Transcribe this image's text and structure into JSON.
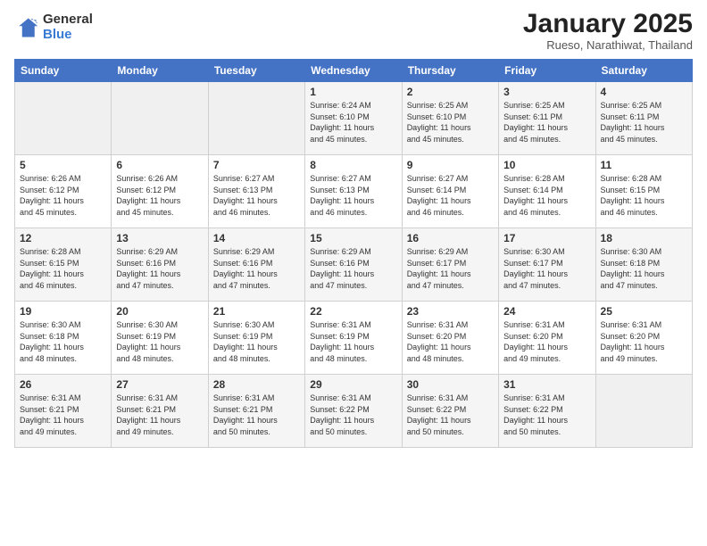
{
  "header": {
    "logo_general": "General",
    "logo_blue": "Blue",
    "title": "January 2025",
    "subtitle": "Rueso, Narathiwat, Thailand"
  },
  "weekdays": [
    "Sunday",
    "Monday",
    "Tuesday",
    "Wednesday",
    "Thursday",
    "Friday",
    "Saturday"
  ],
  "weeks": [
    [
      {
        "day": "",
        "content": ""
      },
      {
        "day": "",
        "content": ""
      },
      {
        "day": "",
        "content": ""
      },
      {
        "day": "1",
        "content": "Sunrise: 6:24 AM\nSunset: 6:10 PM\nDaylight: 11 hours\nand 45 minutes."
      },
      {
        "day": "2",
        "content": "Sunrise: 6:25 AM\nSunset: 6:10 PM\nDaylight: 11 hours\nand 45 minutes."
      },
      {
        "day": "3",
        "content": "Sunrise: 6:25 AM\nSunset: 6:11 PM\nDaylight: 11 hours\nand 45 minutes."
      },
      {
        "day": "4",
        "content": "Sunrise: 6:25 AM\nSunset: 6:11 PM\nDaylight: 11 hours\nand 45 minutes."
      }
    ],
    [
      {
        "day": "5",
        "content": "Sunrise: 6:26 AM\nSunset: 6:12 PM\nDaylight: 11 hours\nand 45 minutes."
      },
      {
        "day": "6",
        "content": "Sunrise: 6:26 AM\nSunset: 6:12 PM\nDaylight: 11 hours\nand 45 minutes."
      },
      {
        "day": "7",
        "content": "Sunrise: 6:27 AM\nSunset: 6:13 PM\nDaylight: 11 hours\nand 46 minutes."
      },
      {
        "day": "8",
        "content": "Sunrise: 6:27 AM\nSunset: 6:13 PM\nDaylight: 11 hours\nand 46 minutes."
      },
      {
        "day": "9",
        "content": "Sunrise: 6:27 AM\nSunset: 6:14 PM\nDaylight: 11 hours\nand 46 minutes."
      },
      {
        "day": "10",
        "content": "Sunrise: 6:28 AM\nSunset: 6:14 PM\nDaylight: 11 hours\nand 46 minutes."
      },
      {
        "day": "11",
        "content": "Sunrise: 6:28 AM\nSunset: 6:15 PM\nDaylight: 11 hours\nand 46 minutes."
      }
    ],
    [
      {
        "day": "12",
        "content": "Sunrise: 6:28 AM\nSunset: 6:15 PM\nDaylight: 11 hours\nand 46 minutes."
      },
      {
        "day": "13",
        "content": "Sunrise: 6:29 AM\nSunset: 6:16 PM\nDaylight: 11 hours\nand 47 minutes."
      },
      {
        "day": "14",
        "content": "Sunrise: 6:29 AM\nSunset: 6:16 PM\nDaylight: 11 hours\nand 47 minutes."
      },
      {
        "day": "15",
        "content": "Sunrise: 6:29 AM\nSunset: 6:16 PM\nDaylight: 11 hours\nand 47 minutes."
      },
      {
        "day": "16",
        "content": "Sunrise: 6:29 AM\nSunset: 6:17 PM\nDaylight: 11 hours\nand 47 minutes."
      },
      {
        "day": "17",
        "content": "Sunrise: 6:30 AM\nSunset: 6:17 PM\nDaylight: 11 hours\nand 47 minutes."
      },
      {
        "day": "18",
        "content": "Sunrise: 6:30 AM\nSunset: 6:18 PM\nDaylight: 11 hours\nand 47 minutes."
      }
    ],
    [
      {
        "day": "19",
        "content": "Sunrise: 6:30 AM\nSunset: 6:18 PM\nDaylight: 11 hours\nand 48 minutes."
      },
      {
        "day": "20",
        "content": "Sunrise: 6:30 AM\nSunset: 6:19 PM\nDaylight: 11 hours\nand 48 minutes."
      },
      {
        "day": "21",
        "content": "Sunrise: 6:30 AM\nSunset: 6:19 PM\nDaylight: 11 hours\nand 48 minutes."
      },
      {
        "day": "22",
        "content": "Sunrise: 6:31 AM\nSunset: 6:19 PM\nDaylight: 11 hours\nand 48 minutes."
      },
      {
        "day": "23",
        "content": "Sunrise: 6:31 AM\nSunset: 6:20 PM\nDaylight: 11 hours\nand 48 minutes."
      },
      {
        "day": "24",
        "content": "Sunrise: 6:31 AM\nSunset: 6:20 PM\nDaylight: 11 hours\nand 49 minutes."
      },
      {
        "day": "25",
        "content": "Sunrise: 6:31 AM\nSunset: 6:20 PM\nDaylight: 11 hours\nand 49 minutes."
      }
    ],
    [
      {
        "day": "26",
        "content": "Sunrise: 6:31 AM\nSunset: 6:21 PM\nDaylight: 11 hours\nand 49 minutes."
      },
      {
        "day": "27",
        "content": "Sunrise: 6:31 AM\nSunset: 6:21 PM\nDaylight: 11 hours\nand 49 minutes."
      },
      {
        "day": "28",
        "content": "Sunrise: 6:31 AM\nSunset: 6:21 PM\nDaylight: 11 hours\nand 50 minutes."
      },
      {
        "day": "29",
        "content": "Sunrise: 6:31 AM\nSunset: 6:22 PM\nDaylight: 11 hours\nand 50 minutes."
      },
      {
        "day": "30",
        "content": "Sunrise: 6:31 AM\nSunset: 6:22 PM\nDaylight: 11 hours\nand 50 minutes."
      },
      {
        "day": "31",
        "content": "Sunrise: 6:31 AM\nSunset: 6:22 PM\nDaylight: 11 hours\nand 50 minutes."
      },
      {
        "day": "",
        "content": ""
      }
    ]
  ]
}
